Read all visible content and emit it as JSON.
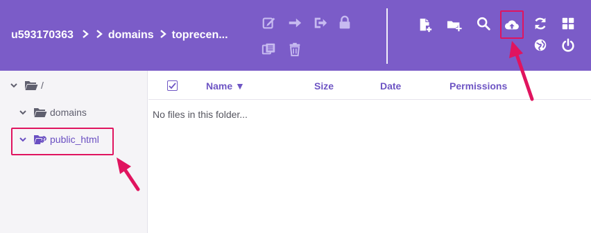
{
  "breadcrumb": {
    "user": "u593170363",
    "folder1": "domains",
    "folder2": "toprecen..."
  },
  "toolbar": {
    "icons_disabled": [
      "edit-icon",
      "move-icon",
      "rename-icon",
      "permissions-lock-icon",
      "extract-icon",
      "delete-icon"
    ],
    "icons_enabled": [
      "new-file-icon",
      "new-folder-icon",
      "search-icon",
      "upload-icon",
      "refresh-icon",
      "grid-view-icon",
      "website-icon",
      "logout-icon"
    ]
  },
  "tree": {
    "root": "/",
    "domains": "domains",
    "public_html": "public_html"
  },
  "table": {
    "col_name": "Name ▼",
    "col_size": "Size",
    "col_date": "Date",
    "col_permissions": "Permissions",
    "empty_message": "No files in this folder..."
  },
  "colors": {
    "topbar": "#7b5cc8",
    "accent": "#6e55c4",
    "highlight": "#e0145f"
  }
}
